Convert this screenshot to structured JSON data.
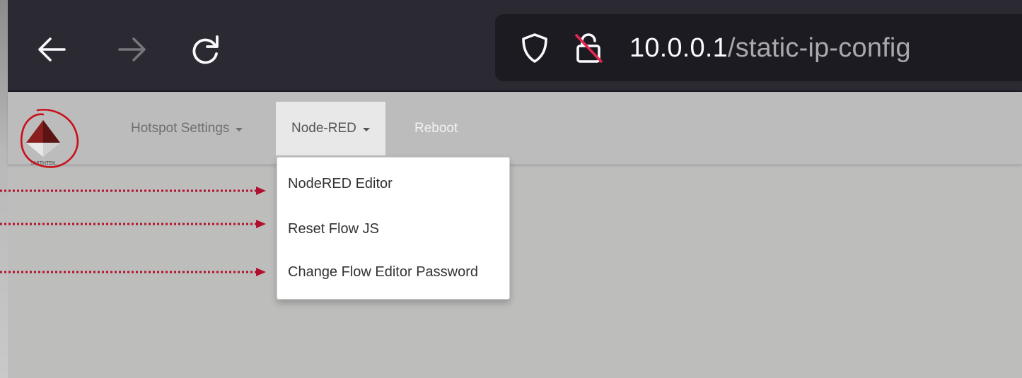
{
  "browser": {
    "url_host": "10.0.0.1",
    "url_path": "/static-ip-config",
    "icons": {
      "back": "arrow-left-icon",
      "forward": "arrow-right-icon",
      "reload": "reload-icon",
      "shield": "shield-icon",
      "insecure_lock": "insecure-lock-icon"
    }
  },
  "navbar": {
    "logo_text": "SMITHTEK",
    "hotspot_label": "Hotspot Settings",
    "nodered_label": "Node-RED",
    "reboot_label": "Reboot"
  },
  "dropdown": {
    "items": [
      {
        "label": "NodeRED Editor"
      },
      {
        "label": "Reset Flow JS"
      },
      {
        "label": "Change Flow Editor Password"
      }
    ]
  },
  "colors": {
    "annotation_red": "#b0102e",
    "toolbar_bg": "#2b2a33",
    "urlbar_bg": "#1c1b22",
    "page_bg": "#bdbdbc"
  }
}
